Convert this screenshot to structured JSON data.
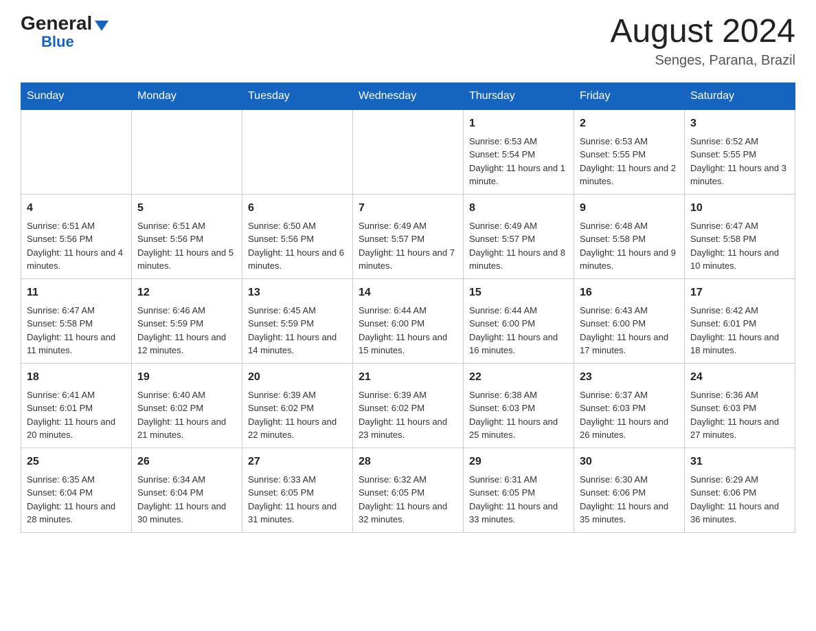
{
  "logo": {
    "general": "General",
    "triangle_alt": "triangle",
    "blue": "Blue"
  },
  "title": "August 2024",
  "location": "Senges, Parana, Brazil",
  "days_of_week": [
    "Sunday",
    "Monday",
    "Tuesday",
    "Wednesday",
    "Thursday",
    "Friday",
    "Saturday"
  ],
  "weeks": [
    [
      {
        "day": "",
        "info": ""
      },
      {
        "day": "",
        "info": ""
      },
      {
        "day": "",
        "info": ""
      },
      {
        "day": "",
        "info": ""
      },
      {
        "day": "1",
        "info": "Sunrise: 6:53 AM\nSunset: 5:54 PM\nDaylight: 11 hours and 1 minute."
      },
      {
        "day": "2",
        "info": "Sunrise: 6:53 AM\nSunset: 5:55 PM\nDaylight: 11 hours and 2 minutes."
      },
      {
        "day": "3",
        "info": "Sunrise: 6:52 AM\nSunset: 5:55 PM\nDaylight: 11 hours and 3 minutes."
      }
    ],
    [
      {
        "day": "4",
        "info": "Sunrise: 6:51 AM\nSunset: 5:56 PM\nDaylight: 11 hours and 4 minutes."
      },
      {
        "day": "5",
        "info": "Sunrise: 6:51 AM\nSunset: 5:56 PM\nDaylight: 11 hours and 5 minutes."
      },
      {
        "day": "6",
        "info": "Sunrise: 6:50 AM\nSunset: 5:56 PM\nDaylight: 11 hours and 6 minutes."
      },
      {
        "day": "7",
        "info": "Sunrise: 6:49 AM\nSunset: 5:57 PM\nDaylight: 11 hours and 7 minutes."
      },
      {
        "day": "8",
        "info": "Sunrise: 6:49 AM\nSunset: 5:57 PM\nDaylight: 11 hours and 8 minutes."
      },
      {
        "day": "9",
        "info": "Sunrise: 6:48 AM\nSunset: 5:58 PM\nDaylight: 11 hours and 9 minutes."
      },
      {
        "day": "10",
        "info": "Sunrise: 6:47 AM\nSunset: 5:58 PM\nDaylight: 11 hours and 10 minutes."
      }
    ],
    [
      {
        "day": "11",
        "info": "Sunrise: 6:47 AM\nSunset: 5:58 PM\nDaylight: 11 hours and 11 minutes."
      },
      {
        "day": "12",
        "info": "Sunrise: 6:46 AM\nSunset: 5:59 PM\nDaylight: 11 hours and 12 minutes."
      },
      {
        "day": "13",
        "info": "Sunrise: 6:45 AM\nSunset: 5:59 PM\nDaylight: 11 hours and 14 minutes."
      },
      {
        "day": "14",
        "info": "Sunrise: 6:44 AM\nSunset: 6:00 PM\nDaylight: 11 hours and 15 minutes."
      },
      {
        "day": "15",
        "info": "Sunrise: 6:44 AM\nSunset: 6:00 PM\nDaylight: 11 hours and 16 minutes."
      },
      {
        "day": "16",
        "info": "Sunrise: 6:43 AM\nSunset: 6:00 PM\nDaylight: 11 hours and 17 minutes."
      },
      {
        "day": "17",
        "info": "Sunrise: 6:42 AM\nSunset: 6:01 PM\nDaylight: 11 hours and 18 minutes."
      }
    ],
    [
      {
        "day": "18",
        "info": "Sunrise: 6:41 AM\nSunset: 6:01 PM\nDaylight: 11 hours and 20 minutes."
      },
      {
        "day": "19",
        "info": "Sunrise: 6:40 AM\nSunset: 6:02 PM\nDaylight: 11 hours and 21 minutes."
      },
      {
        "day": "20",
        "info": "Sunrise: 6:39 AM\nSunset: 6:02 PM\nDaylight: 11 hours and 22 minutes."
      },
      {
        "day": "21",
        "info": "Sunrise: 6:39 AM\nSunset: 6:02 PM\nDaylight: 11 hours and 23 minutes."
      },
      {
        "day": "22",
        "info": "Sunrise: 6:38 AM\nSunset: 6:03 PM\nDaylight: 11 hours and 25 minutes."
      },
      {
        "day": "23",
        "info": "Sunrise: 6:37 AM\nSunset: 6:03 PM\nDaylight: 11 hours and 26 minutes."
      },
      {
        "day": "24",
        "info": "Sunrise: 6:36 AM\nSunset: 6:03 PM\nDaylight: 11 hours and 27 minutes."
      }
    ],
    [
      {
        "day": "25",
        "info": "Sunrise: 6:35 AM\nSunset: 6:04 PM\nDaylight: 11 hours and 28 minutes."
      },
      {
        "day": "26",
        "info": "Sunrise: 6:34 AM\nSunset: 6:04 PM\nDaylight: 11 hours and 30 minutes."
      },
      {
        "day": "27",
        "info": "Sunrise: 6:33 AM\nSunset: 6:05 PM\nDaylight: 11 hours and 31 minutes."
      },
      {
        "day": "28",
        "info": "Sunrise: 6:32 AM\nSunset: 6:05 PM\nDaylight: 11 hours and 32 minutes."
      },
      {
        "day": "29",
        "info": "Sunrise: 6:31 AM\nSunset: 6:05 PM\nDaylight: 11 hours and 33 minutes."
      },
      {
        "day": "30",
        "info": "Sunrise: 6:30 AM\nSunset: 6:06 PM\nDaylight: 11 hours and 35 minutes."
      },
      {
        "day": "31",
        "info": "Sunrise: 6:29 AM\nSunset: 6:06 PM\nDaylight: 11 hours and 36 minutes."
      }
    ]
  ]
}
